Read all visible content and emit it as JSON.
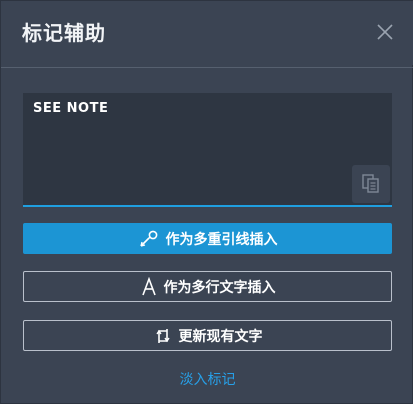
{
  "header": {
    "title": "标记辅助",
    "close_icon": "close-icon"
  },
  "editor": {
    "value": "SEE NOTE",
    "copy_icon": "copy-icon"
  },
  "buttons": {
    "multileader_label": "作为多重引线插入",
    "multileader_icon": "multileader-icon",
    "mtext_label": "作为多行文字插入",
    "mtext_icon": "text-a-icon",
    "update_label": "更新现有文字",
    "update_icon": "refresh-swap-icon"
  },
  "footer": {
    "fade_link": "淡入标记"
  },
  "colors": {
    "background": "#3b4453",
    "editor_bg": "#2e3642",
    "accent": "#1c95d4",
    "link": "#27a0e8"
  }
}
